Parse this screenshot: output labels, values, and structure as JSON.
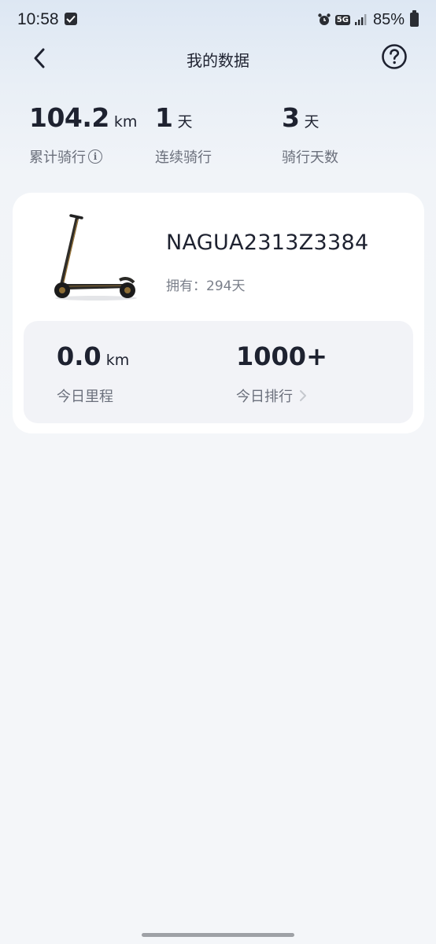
{
  "status_bar": {
    "time": "10:58",
    "network": "5G",
    "battery": "85%"
  },
  "header": {
    "title": "我的数据",
    "back_icon": "chevron-left-icon",
    "help_icon": "help-circle-icon"
  },
  "summary": {
    "total_distance": {
      "value": "104.2",
      "unit": "km",
      "label": "累计骑行"
    },
    "streak": {
      "value": "1",
      "unit": "天",
      "label": "连续骑行"
    },
    "ride_days": {
      "value": "3",
      "unit": "天",
      "label": "骑行天数"
    }
  },
  "device": {
    "name": "NAGUA2313Z3384",
    "owned": "拥有：294天",
    "image_icon": "scooter-image"
  },
  "today": {
    "distance": {
      "value": "0.0",
      "unit": "km",
      "label": "今日里程"
    },
    "rank": {
      "value": "1000+",
      "label": "今日排行"
    }
  },
  "colors": {
    "background": "#f4f6f9",
    "header_gradient_top": "#dde7f3",
    "card": "#ffffff",
    "today_box": "#f2f3f7",
    "text_primary": "#1e2230",
    "text_secondary": "#6b707c"
  }
}
